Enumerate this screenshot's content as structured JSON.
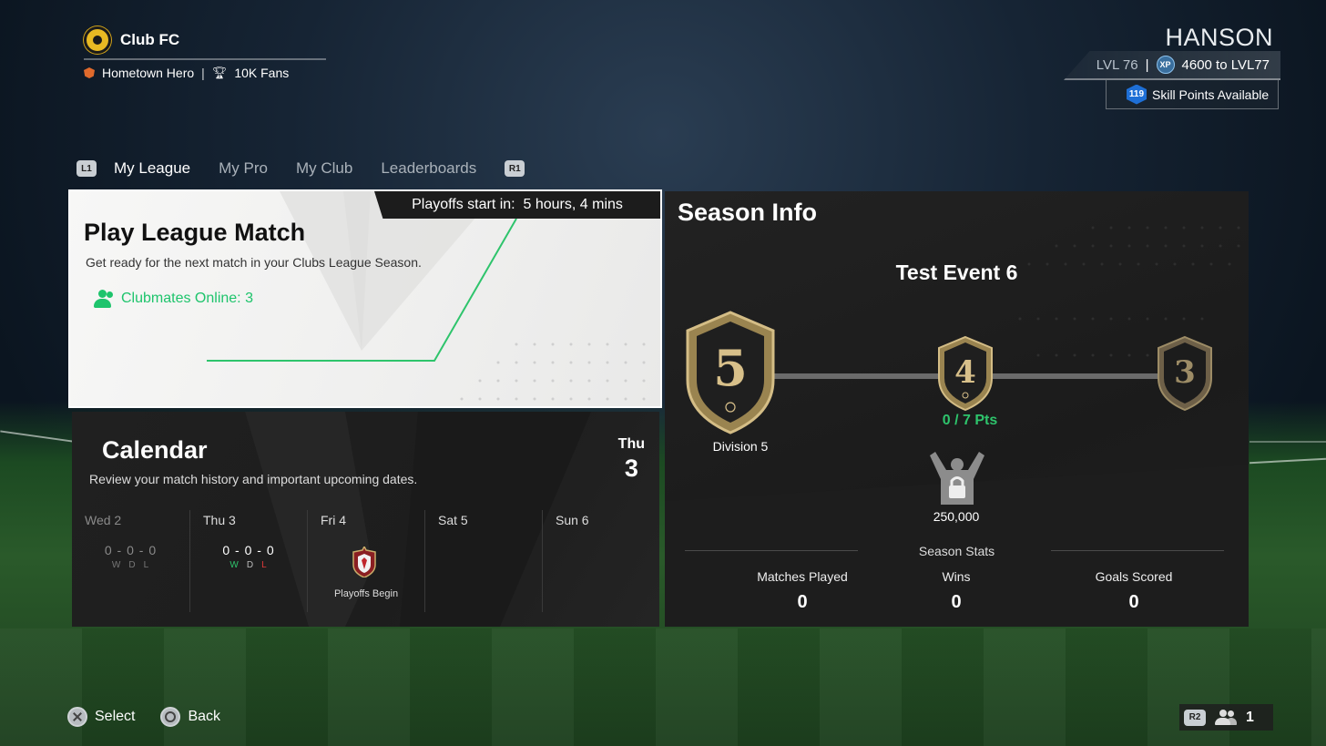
{
  "header": {
    "club_name": "Club FC",
    "status": "Hometown Hero",
    "separator": "|",
    "fans": "10K Fans"
  },
  "player": {
    "name": "HANSON",
    "level_current": "LVL 76",
    "level_separator": "|",
    "xp_label": "XP",
    "xp_to_next": "4600 to LVL77",
    "skill_points_count": "119",
    "skill_points_label": "Skill Points Available"
  },
  "tabs": {
    "left_bumper": "L1",
    "right_bumper": "R1",
    "items": [
      {
        "label": "My League",
        "active": true
      },
      {
        "label": "My Pro",
        "active": false
      },
      {
        "label": "My Club",
        "active": false
      },
      {
        "label": "Leaderboards",
        "active": false
      }
    ]
  },
  "play_league": {
    "playoffs_label": "Playoffs start in:",
    "playoffs_time": "5 hours, 4 mins",
    "title": "Play League Match",
    "description": "Get ready for the next match in your Clubs League Season.",
    "clubmates_online": "Clubmates Online: 3"
  },
  "calendar": {
    "title": "Calendar",
    "description": "Review your match history and important upcoming dates.",
    "today_dow": "Thu",
    "today_num": "3",
    "days": [
      {
        "label": "Wed 2",
        "score": "0 - 0 - 0",
        "w": "W",
        "d": "D",
        "l": "L"
      },
      {
        "label": "Thu 3",
        "score": "0 - 0 - 0",
        "w": "W",
        "d": "D",
        "l": "L"
      },
      {
        "label": "Fri 4",
        "event": "Playoffs Begin"
      },
      {
        "label": "Sat 5"
      },
      {
        "label": "Sun 6"
      }
    ]
  },
  "season": {
    "title": "Season Info",
    "event_name": "Test Event 6",
    "divisions": {
      "current": "5",
      "next": "4",
      "after": "3",
      "current_label": "Division 5"
    },
    "points": "0 / 7 Pts",
    "reward_value": "250,000",
    "stats_heading": "Season Stats",
    "stats": [
      {
        "label": "Matches Played",
        "value": "0"
      },
      {
        "label": "Wins",
        "value": "0"
      },
      {
        "label": "Goals Scored",
        "value": "0"
      }
    ]
  },
  "footer": {
    "select_label": "Select",
    "back_label": "Back",
    "r2_label": "R2",
    "party_count": "1"
  },
  "colors": {
    "accent_green": "#2ec46c",
    "loss_red": "#e03a3a",
    "shield_gold": "#c9ad6a",
    "skill_blue": "#1e6fd6"
  }
}
